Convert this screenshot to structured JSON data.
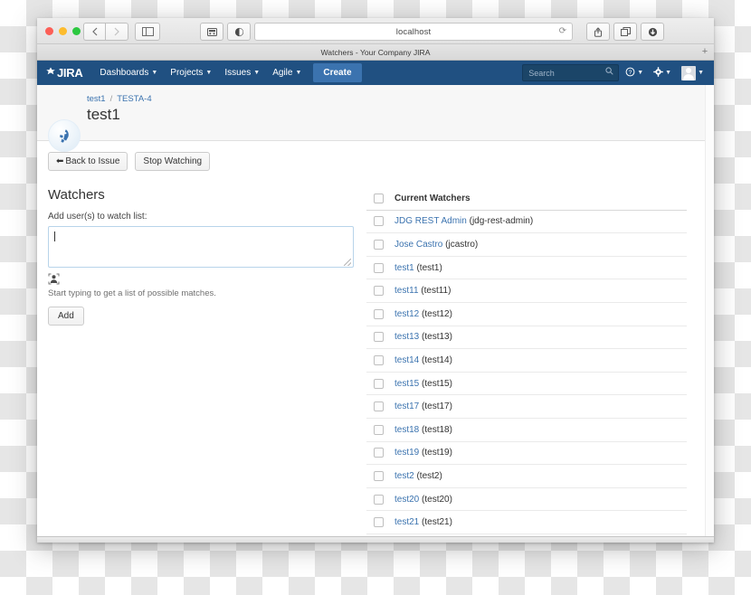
{
  "browser": {
    "url": "localhost",
    "tab_title": "Watchers - Your Company JIRA",
    "new_tab_label": "+",
    "icons": {
      "back": "back-icon",
      "forward": "forward-icon",
      "sidebar": "sidebar-icon",
      "reader": "reader-icon",
      "privacy": "privacy-icon",
      "reload": "reload-icon",
      "share": "share-icon",
      "tabs": "tabs-icon",
      "downloads": "downloads-icon"
    }
  },
  "jira_nav": {
    "logo_text": "JIRA",
    "items": [
      {
        "label": "Dashboards",
        "has_caret": true
      },
      {
        "label": "Projects",
        "has_caret": true
      },
      {
        "label": "Issues",
        "has_caret": true
      },
      {
        "label": "Agile",
        "has_caret": true
      }
    ],
    "create_label": "Create",
    "search_placeholder": "Search",
    "help_icon": "help-icon",
    "settings_icon": "gear-icon",
    "profile_icon": "avatar-icon",
    "bar_color": "#205081",
    "create_color": "#3b73af"
  },
  "issue": {
    "breadcrumb_project": "test1",
    "breadcrumb_sep": "/",
    "breadcrumb_key": "TESTA-4",
    "title": "test1",
    "avatar_icon": "rocket-icon"
  },
  "actions": {
    "back_to_issue": "Back to Issue",
    "back_arrow": "⬅",
    "stop_watching": "Stop Watching"
  },
  "watchers_form": {
    "section_title": "Watchers",
    "field_label": "Add user(s) to watch list:",
    "textarea_value": "",
    "picker_icon": "user-picker-icon",
    "hint": "Start typing to get a list of possible matches.",
    "add_label": "Add"
  },
  "watchers_list": {
    "header": "Current Watchers",
    "rows": [
      {
        "name": "JDG REST Admin",
        "username": "(jdg-rest-admin)"
      },
      {
        "name": "Jose Castro",
        "username": "(jcastro)"
      },
      {
        "name": "test1",
        "username": "(test1)"
      },
      {
        "name": "test11",
        "username": "(test11)"
      },
      {
        "name": "test12",
        "username": "(test12)"
      },
      {
        "name": "test13",
        "username": "(test13)"
      },
      {
        "name": "test14",
        "username": "(test14)"
      },
      {
        "name": "test15",
        "username": "(test15)"
      },
      {
        "name": "test17",
        "username": "(test17)"
      },
      {
        "name": "test18",
        "username": "(test18)"
      },
      {
        "name": "test19",
        "username": "(test19)"
      },
      {
        "name": "test2",
        "username": "(test2)"
      },
      {
        "name": "test20",
        "username": "(test20)"
      },
      {
        "name": "test21",
        "username": "(test21)"
      }
    ]
  }
}
